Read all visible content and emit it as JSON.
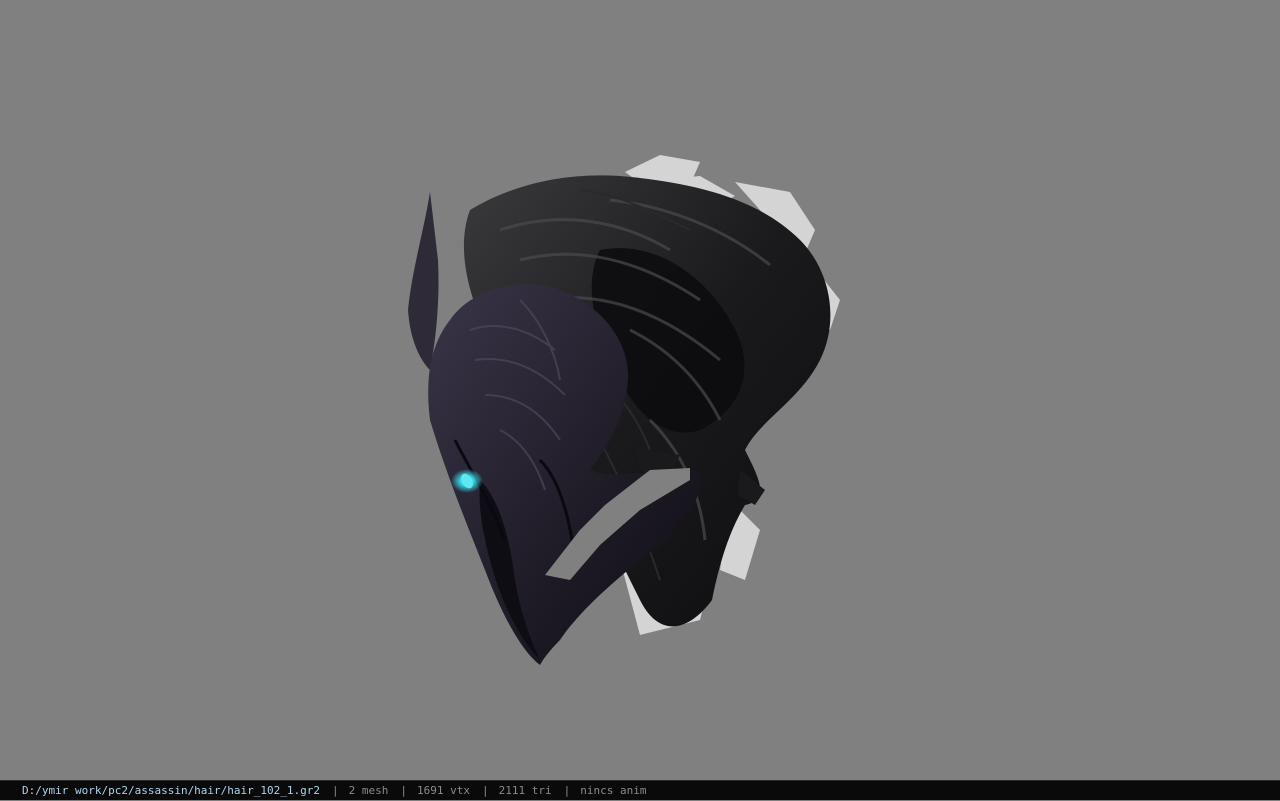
{
  "status_bar": {
    "file_path": "D:/ymir work/pc2/assassin/hair/hair_102_1.gr2",
    "separator": "|",
    "mesh_count": "2 mesh",
    "vertex_count": "1691 vtx",
    "triangle_count": "2111 tri",
    "animation": "nincs anim"
  },
  "colors": {
    "viewport_background": "#808080",
    "status_bar_background": "#0a0a0a",
    "path_text": "#a9d4ea",
    "field_text": "#8a8a8a",
    "model_dark": "#141216",
    "model_highlight": "#d9d9d9",
    "eye_glow": "#35d6e6"
  }
}
